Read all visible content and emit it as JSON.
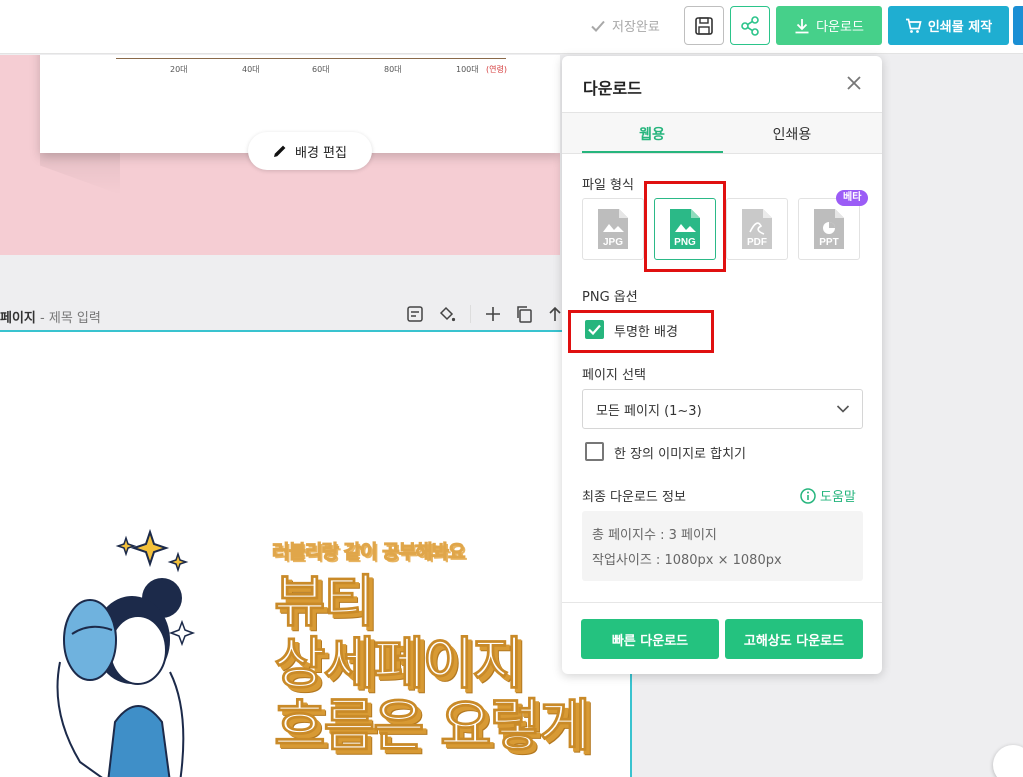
{
  "toolbar": {
    "saved_label": "저장완료",
    "download_label": "다운로드",
    "print_label": "인쇄물 제작"
  },
  "canvas": {
    "axis_ticks": [
      "20대",
      "40대",
      "60대",
      "80대",
      "100대",
      "(연령)"
    ],
    "bg_edit_label": "배경 편집",
    "page_label_bold": "페이지",
    "page_label_sub": "- 제목 입력",
    "sub_headline": "러블리랑 같이 공부해봐요",
    "headline_lines": [
      "뷰티",
      "상세페이지",
      "흐름은 요렇게"
    ]
  },
  "panel": {
    "title": "다운로드",
    "tabs": [
      {
        "label": "웹용",
        "active": true
      },
      {
        "label": "인쇄용",
        "active": false
      }
    ],
    "file_format_label": "파일 형식",
    "formats": [
      {
        "label": "JPG",
        "selected": false
      },
      {
        "label": "PNG",
        "selected": true
      },
      {
        "label": "PDF",
        "selected": false
      },
      {
        "label": "PPT",
        "selected": false
      }
    ],
    "beta_badge": "베타",
    "png_options_label": "PNG 옵션",
    "transparent_bg_label": "투명한 배경",
    "transparent_bg_checked": true,
    "page_select_label": "페이지 선택",
    "page_select_value": "모든 페이지 (1~3)",
    "merge_label": "한 장의 이미지로 합치기",
    "merge_checked": false,
    "final_info_label": "최종 다운로드 정보",
    "help_label": "도움말",
    "info_total_pages": "총 페이지수 : 3 페이지",
    "info_size": "작업사이즈 : 1080px × 1080px",
    "quick_download_label": "빠른 다운로드",
    "hires_download_label": "고해상도 다운로드"
  },
  "colors": {
    "accent_green": "#26b57d",
    "print_blue": "#1faed1",
    "beta_purple": "#9b5cf6",
    "highlight_red": "#e01010"
  }
}
